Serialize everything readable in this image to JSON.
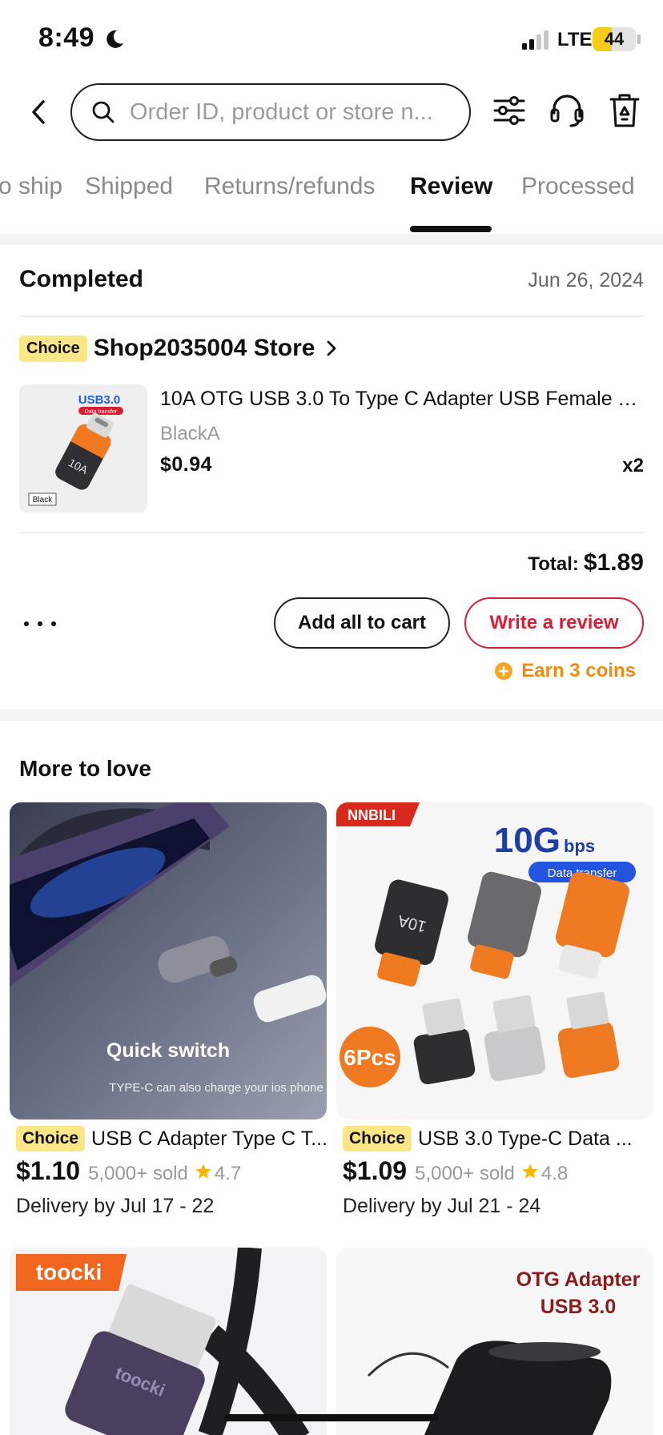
{
  "status_bar": {
    "time": "8:49",
    "network": "LTE",
    "battery": "44",
    "battery_level": 0.44,
    "battery_color": "#f5cc18"
  },
  "search": {
    "placeholder": "Order ID, product or store n..."
  },
  "toolbar_icons": [
    "filter-icon",
    "headset-icon",
    "delete-icon"
  ],
  "tabs": [
    {
      "label": "o ship",
      "active": false
    },
    {
      "label": "Shipped",
      "active": false
    },
    {
      "label": "Returns/refunds",
      "active": false
    },
    {
      "label": "Review",
      "active": true
    },
    {
      "label": "Processed",
      "active": false
    }
  ],
  "order": {
    "status": "Completed",
    "date": "Jun 26, 2024",
    "badge": "Choice",
    "store": "Shop2035004 Store",
    "product": {
      "title": "10A OTG USB 3.0 To Type C Adapter USB Female To T...",
      "variant": "BlackA",
      "price": "$0.94",
      "qty": "x2",
      "image_text": {
        "usb_label": "USB3.0",
        "data_label": "Data transfer",
        "adapter_mark": "10A",
        "color_tag": "Black"
      }
    },
    "total_label": "Total:",
    "total_value": "$1.89",
    "add_cart_label": "Add all to cart",
    "review_label": "Write a review",
    "coins_label": "Earn 3 coins"
  },
  "more_to_love": {
    "title": "More to love",
    "cards": [
      {
        "badge": "Choice",
        "title": "USB C Adapter Type C T...",
        "price": "$1.10",
        "sold": "5,000+ sold",
        "rating": "4.7",
        "delivery": "Delivery by Jul 17 - 22",
        "image_text": {
          "headline": "Quick switch",
          "sub": "TYPE-C can also charge your ios phone"
        }
      },
      {
        "badge": "Choice",
        "title": "USB 3.0 Type-C Data ...",
        "price": "$1.09",
        "sold": "5,000+ sold",
        "rating": "4.8",
        "delivery": "Delivery by Jul 21 - 24",
        "image_text": {
          "brand": "NNBILI",
          "speed": "10G",
          "speed_unit": "bps",
          "data": "Data transfer",
          "pcs": "6Pcs",
          "mark": "10A"
        }
      },
      {
        "image_text": {
          "brand": "toocki",
          "cable_mark": "toocki"
        }
      },
      {
        "image_text": {
          "line1": "OTG Adapter",
          "line2": "USB 3.0"
        }
      }
    ]
  },
  "colors": {
    "accent_red": "#d81e33",
    "choice_yellow": "#fde686",
    "coins_orange": "#f08a12",
    "star_gold": "#f5b800"
  }
}
